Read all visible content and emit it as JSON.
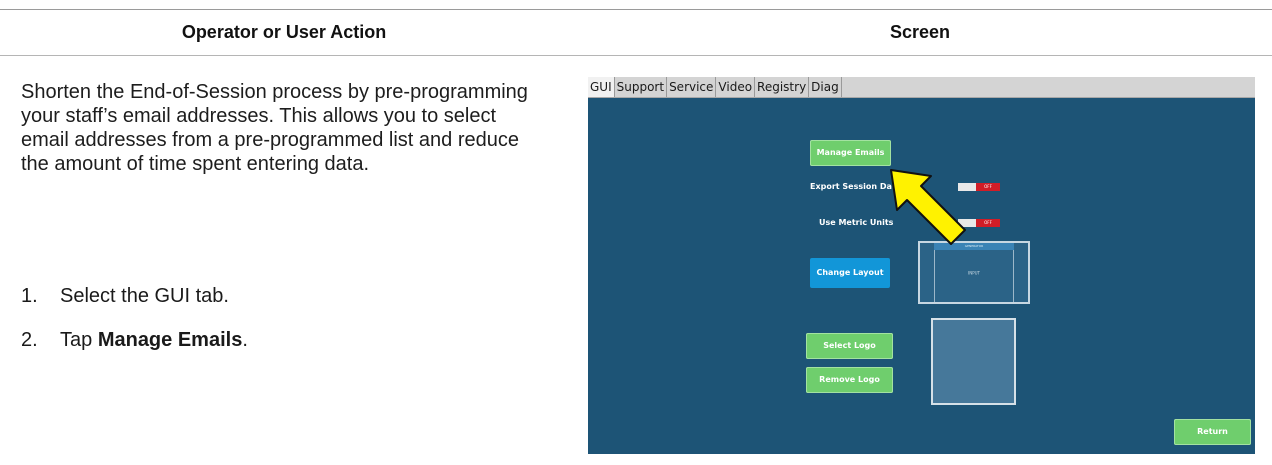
{
  "table": {
    "header_left": "Operator or User Action",
    "header_right": "Screen"
  },
  "instructions": {
    "paragraph": "Shorten the End-of-Session process by pre-programming your staff’s email addresses. This allows you to select email addresses from a pre-programmed list and reduce the amount of time spent entering data.",
    "steps": [
      {
        "num": "1.",
        "text": "Select the GUI tab."
      },
      {
        "num": "2.",
        "prefix": "Tap ",
        "bold": "Manage Emails",
        "suffix": "."
      }
    ]
  },
  "screen": {
    "tabs": [
      "GUI",
      "Support",
      "Service",
      "Video",
      "Registry",
      "Diag"
    ],
    "manage_emails_label": "Manage Emails",
    "export_session_label": "Export Session Da",
    "use_metric_label": "Use Metric Units",
    "toggle_off_label": "OFF",
    "change_layout_label": "Change Layout",
    "layout_preview_top": "GENERATOR",
    "layout_preview_center": "INPUT",
    "select_logo_label": "Select Logo",
    "remove_logo_label": "Remove Logo",
    "return_label": "Return",
    "arrow_color": "#ffff00",
    "background_color": "#1d5476"
  }
}
